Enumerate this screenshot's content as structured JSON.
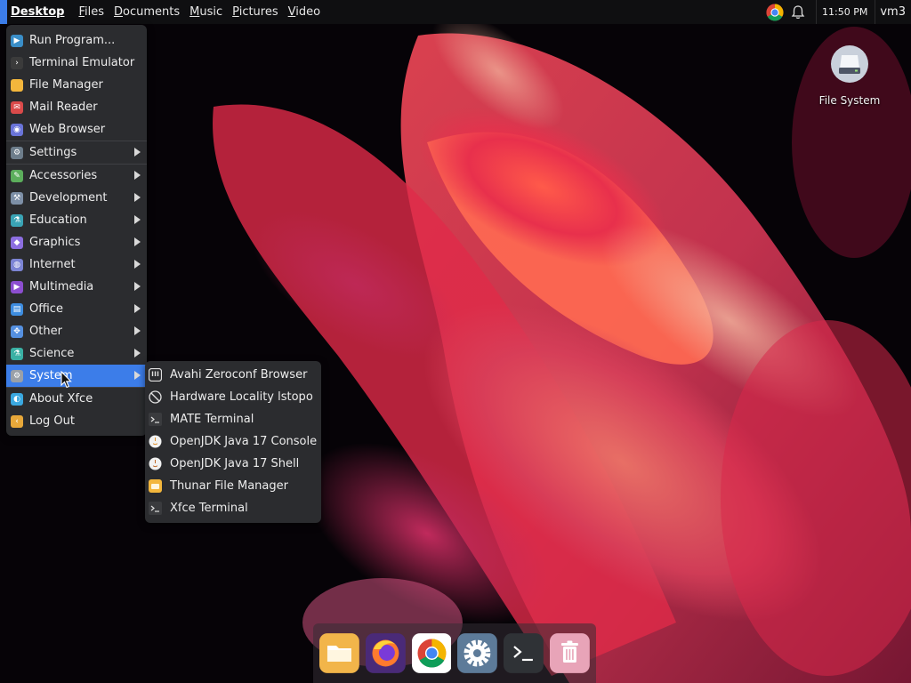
{
  "panel": {
    "title": "Desktop",
    "places": [
      "Files",
      "Documents",
      "Music",
      "Pictures",
      "Video"
    ],
    "clock": "11:50 PM",
    "user": "vm3",
    "accent": "#3c7de9"
  },
  "app_menu": {
    "items": [
      {
        "label": "Run Program...",
        "icon": "run-program-icon",
        "color": "#3a8ec8"
      },
      {
        "label": "Terminal Emulator",
        "icon": "terminal-icon",
        "color": "#3b3b3b"
      },
      {
        "label": "File Manager",
        "icon": "folder-icon",
        "color": "#f3b63c"
      },
      {
        "label": "Mail Reader",
        "icon": "mail-icon",
        "color": "#d94a4a"
      },
      {
        "label": "Web Browser",
        "icon": "web-browser-icon",
        "color": "#6a74d8"
      },
      {
        "label": "Settings",
        "icon": "settings-icon",
        "color": "#6d7d8b",
        "submenu": true
      },
      {
        "label": "Accessories",
        "icon": "accessories-icon",
        "color": "#5cae5c",
        "submenu": true
      },
      {
        "label": "Development",
        "icon": "development-icon",
        "color": "#7d8fa6",
        "submenu": true
      },
      {
        "label": "Education",
        "icon": "education-icon",
        "color": "#3aa4b5",
        "submenu": true
      },
      {
        "label": "Graphics",
        "icon": "graphics-icon",
        "color": "#8c6ee0",
        "submenu": true
      },
      {
        "label": "Internet",
        "icon": "internet-icon",
        "color": "#7c84d4",
        "submenu": true
      },
      {
        "label": "Multimedia",
        "icon": "multimedia-icon",
        "color": "#8c4ed0",
        "submenu": true
      },
      {
        "label": "Office",
        "icon": "office-icon",
        "color": "#3e8de0",
        "submenu": true
      },
      {
        "label": "Other",
        "icon": "other-icon",
        "color": "#5590e0",
        "submenu": true
      },
      {
        "label": "Science",
        "icon": "science-icon",
        "color": "#3ab0a4",
        "submenu": true
      },
      {
        "label": "System",
        "icon": "system-icon",
        "color": "#9aa0a8",
        "submenu": true,
        "active": true
      },
      {
        "label": "About Xfce",
        "icon": "xfce-icon",
        "color": "#3aa8e0"
      },
      {
        "label": "Log Out",
        "icon": "logout-icon",
        "color": "#e8a83a"
      }
    ]
  },
  "system_submenu": {
    "items": [
      {
        "label": "Avahi Zeroconf Browser",
        "icon": "avahi-icon"
      },
      {
        "label": "Hardware Locality lstopo",
        "icon": "lstopo-icon"
      },
      {
        "label": "MATE Terminal",
        "icon": "mate-terminal-icon"
      },
      {
        "label": "OpenJDK Java 17 Console",
        "icon": "java-console-icon"
      },
      {
        "label": "OpenJDK Java 17 Shell",
        "icon": "java-shell-icon"
      },
      {
        "label": "Thunar File Manager",
        "icon": "thunar-icon"
      },
      {
        "label": "Xfce Terminal",
        "icon": "xfce-terminal-icon"
      }
    ]
  },
  "desktop_icons": [
    {
      "label": "File System",
      "icon": "drive-icon"
    }
  ],
  "dock": {
    "items": [
      {
        "name": "files",
        "icon": "folder-icon"
      },
      {
        "name": "firefox",
        "icon": "firefox-icon"
      },
      {
        "name": "chrome",
        "icon": "chrome-icon"
      },
      {
        "name": "settings",
        "icon": "gear-icon"
      },
      {
        "name": "terminal",
        "icon": "terminal-icon"
      },
      {
        "name": "trash",
        "icon": "trash-icon"
      }
    ]
  }
}
